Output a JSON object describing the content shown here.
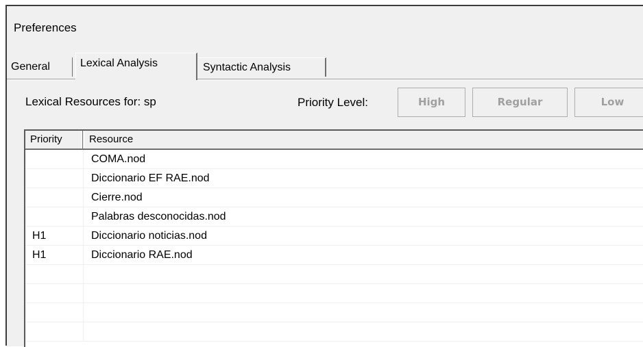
{
  "window": {
    "title": "Preferences"
  },
  "tabs": [
    {
      "label": "General",
      "active": false
    },
    {
      "label": "Lexical Analysis",
      "active": true
    },
    {
      "label": "Syntactic Analysis",
      "active": false
    }
  ],
  "lexical": {
    "resources_label": "Lexical Resources for: sp",
    "priority_label": "Priority Level:",
    "buttons": {
      "high": "High",
      "regular": "Regular",
      "low": "Low"
    }
  },
  "list": {
    "columns": {
      "priority": "Priority",
      "resource": "Resource"
    },
    "rows": [
      {
        "priority": "",
        "resource": "COMA.nod"
      },
      {
        "priority": "",
        "resource": "Diccionario EF RAE.nod"
      },
      {
        "priority": "",
        "resource": "Cierre.nod"
      },
      {
        "priority": "",
        "resource": "Palabras desconocidas.nod"
      },
      {
        "priority": "H1",
        "resource": "Diccionario noticias.nod"
      },
      {
        "priority": "H1",
        "resource": "Diccionario RAE.nod"
      },
      {
        "priority": "",
        "resource": ""
      },
      {
        "priority": "",
        "resource": ""
      },
      {
        "priority": "",
        "resource": ""
      },
      {
        "priority": "",
        "resource": ""
      }
    ]
  },
  "colors": {
    "disabled_text": "#a0a0a0",
    "panel_bg": "#f0f0f0"
  }
}
